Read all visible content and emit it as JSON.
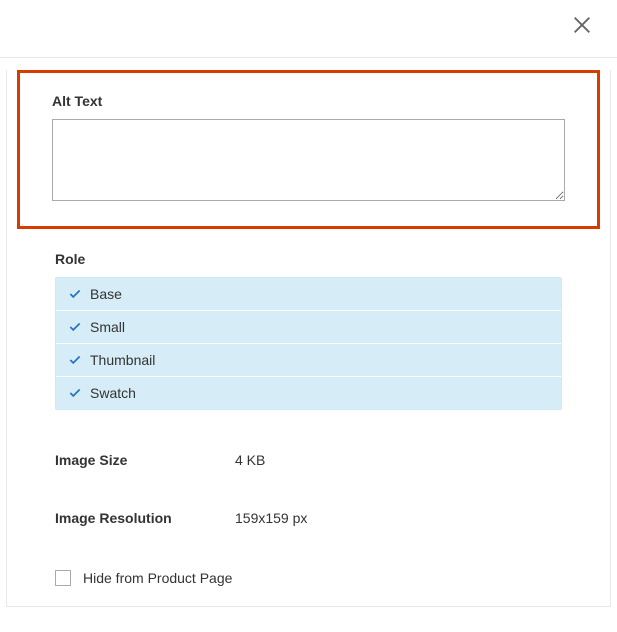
{
  "altText": {
    "label": "Alt Text",
    "value": ""
  },
  "role": {
    "label": "Role",
    "items": [
      {
        "label": "Base"
      },
      {
        "label": "Small"
      },
      {
        "label": "Thumbnail"
      },
      {
        "label": "Swatch"
      }
    ]
  },
  "imageSize": {
    "label": "Image Size",
    "value": "4 KB"
  },
  "imageResolution": {
    "label": "Image Resolution",
    "value": "159x159 px"
  },
  "hideFromProductPage": {
    "label": "Hide from Product Page"
  }
}
